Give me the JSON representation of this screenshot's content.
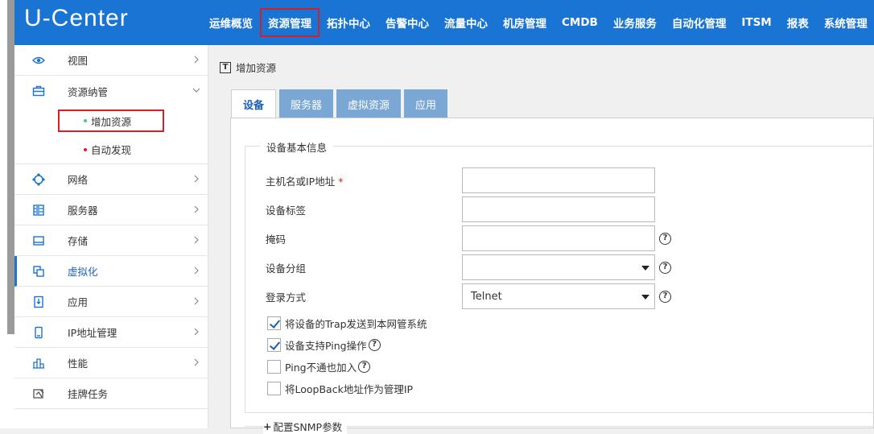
{
  "app": {
    "logo": "U-Center"
  },
  "nav": {
    "items": [
      "运维概览",
      "资源管理",
      "拓扑中心",
      "告警中心",
      "流量中心",
      "机房管理",
      "CMDB",
      "业务服务",
      "自动化管理",
      "ITSM",
      "报表",
      "系统管理"
    ],
    "active": "资源管理"
  },
  "sidebar": {
    "items": [
      {
        "label": "视图",
        "icon": "eye-icon"
      },
      {
        "label": "资源纳管",
        "icon": "briefcase-icon"
      },
      {
        "label": "网络",
        "icon": "network-icon"
      },
      {
        "label": "服务器",
        "icon": "server-icon"
      },
      {
        "label": "存储",
        "icon": "storage-icon"
      },
      {
        "label": "虚拟化",
        "icon": "copy-icon"
      },
      {
        "label": "应用",
        "icon": "application-icon"
      },
      {
        "label": "IP地址管理",
        "icon": "mobile-icon"
      },
      {
        "label": "性能",
        "icon": "performance-icon"
      },
      {
        "label": "挂牌任务",
        "icon": "tag-icon"
      }
    ],
    "subitems": [
      {
        "label": "增加资源",
        "dot_color": "#4cc0a0"
      },
      {
        "label": "自动发现",
        "dot_color": "#d0202a"
      }
    ]
  },
  "breadcrumb": {
    "icon_text": "T",
    "title": "增加资源"
  },
  "tabs": [
    "设备",
    "服务器",
    "虚拟资源",
    "应用"
  ],
  "form": {
    "legend": "设备基本信息",
    "fields": [
      {
        "label": "主机名或IP地址",
        "required": "*",
        "value": ""
      },
      {
        "label": "设备标签",
        "value": ""
      },
      {
        "label": "掩码",
        "value": ""
      },
      {
        "label": "设备分组",
        "value": ""
      },
      {
        "label": "登录方式",
        "value": "Telnet"
      }
    ],
    "help_glyph": "?",
    "checkboxes": [
      {
        "label": "将设备的Trap发送到本网管系统",
        "checked": true
      },
      {
        "label": "设备支持Ping操作",
        "checked": true
      },
      {
        "label": "Ping不通也加入",
        "checked": false
      },
      {
        "label": "将LoopBack地址作为管理IP",
        "checked": false
      }
    ],
    "snmp_section": "配置SNMP参数",
    "snmp_plus": "+"
  },
  "colors": {
    "header_bg": "#1a74d3",
    "highlight_box": "#d0202a",
    "tab_inactive": "#7aa7d3"
  }
}
